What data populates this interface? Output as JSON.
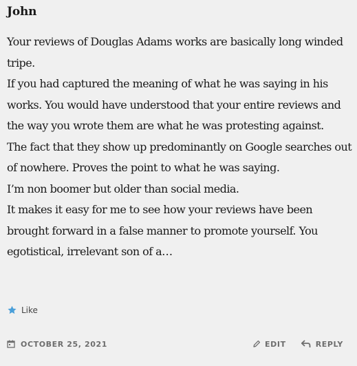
{
  "comment": {
    "author": "John",
    "paragraphs": [
      "Your reviews of Douglas Adams works are basically long winded tripe.",
      "If you had captured the meaning of what he was saying in his works. You would have understood that your entire reviews and the way you wrote them are what he was protesting against.",
      "The fact that they show up predominantly on Google searches out of nowhere. Proves the point to what he was saying.",
      "I’m non boomer but older than social media.",
      "It makes it easy for me to see how your reviews have been brought forward in a false manner to promote yourself. You egotistical, irrelevant son of a…"
    ],
    "like_label": "Like",
    "date": "OCTOBER 25, 2021",
    "edit_label": "EDIT",
    "reply_label": "REPLY"
  },
  "icons": {
    "like": "star-icon",
    "date": "calendar-icon",
    "edit": "pencil-icon",
    "reply": "reply-arrow-icon"
  },
  "colors": {
    "background": "#f0f0f0",
    "star": "#4a9fd9",
    "meta": "#6d6d6d"
  }
}
